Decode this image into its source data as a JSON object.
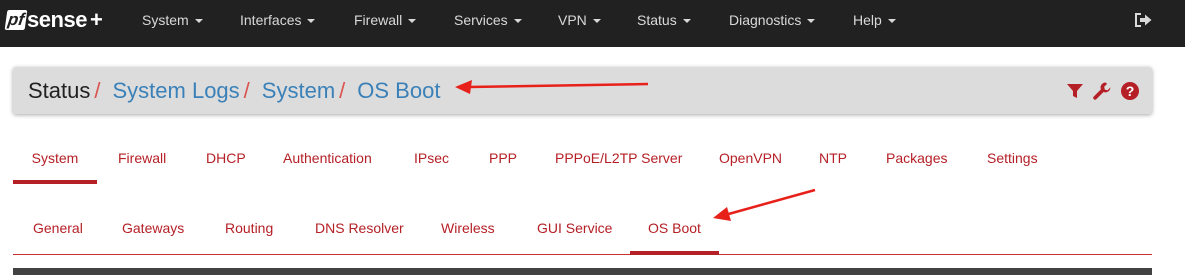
{
  "brand": {
    "pf": "pf",
    "sense": "sense",
    "plus": "+"
  },
  "nav": {
    "items": [
      {
        "label": "System"
      },
      {
        "label": "Interfaces"
      },
      {
        "label": "Firewall"
      },
      {
        "label": "Services"
      },
      {
        "label": "VPN"
      },
      {
        "label": "Status"
      },
      {
        "label": "Diagnostics"
      },
      {
        "label": "Help"
      }
    ],
    "logout_icon": "sign-out-icon"
  },
  "breadcrumb": {
    "root": "Status",
    "separator": "/",
    "links": [
      "System Logs",
      "System",
      "OS Boot"
    ],
    "icons": [
      "filter-icon",
      "wrench-icon",
      "question-circle-icon"
    ]
  },
  "tabs": {
    "items": [
      "System",
      "Firewall",
      "DHCP",
      "Authentication",
      "IPsec",
      "PPP",
      "PPPoE/L2TP Server",
      "OpenVPN",
      "NTP",
      "Packages",
      "Settings"
    ],
    "active": "System"
  },
  "subtabs": {
    "items": [
      "General",
      "Gateways",
      "Routing",
      "DNS Resolver",
      "Wireless",
      "GUI Service",
      "OS Boot"
    ],
    "active": "OS Boot"
  },
  "colors": {
    "navbar": "#212121",
    "accent_red": "#b51f26",
    "link_blue": "#3a81b9",
    "panel_bg": "#dcdcdc",
    "annotation_red": "#e8201a"
  }
}
